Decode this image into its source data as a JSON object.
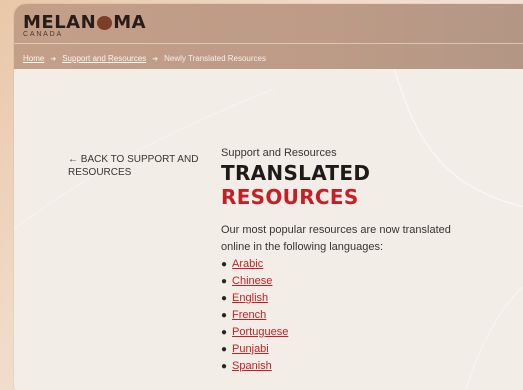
{
  "brand": {
    "logo_pre": "MELAN",
    "logo_post": "MA",
    "logo_sub": "CANADA"
  },
  "breadcrumb": {
    "home": "Home",
    "support": "Support and Resources",
    "current": "Newly Translated Resources"
  },
  "sidebar": {
    "back_link": "← BACK TO SUPPORT AND RESOURCES"
  },
  "main": {
    "section_label": "Support and Resources",
    "title_line1": "TRANSLATED",
    "title_line2": "RESOURCES",
    "intro": "Our most popular resources are now translated online in the following languages:",
    "languages": [
      "Arabic",
      "Chinese",
      "English",
      "French",
      "Portuguese",
      "Punjabi",
      "Spanish"
    ]
  },
  "colors": {
    "accent": "#c41f24",
    "header": "#c09e89",
    "background": "#f3ede7"
  }
}
